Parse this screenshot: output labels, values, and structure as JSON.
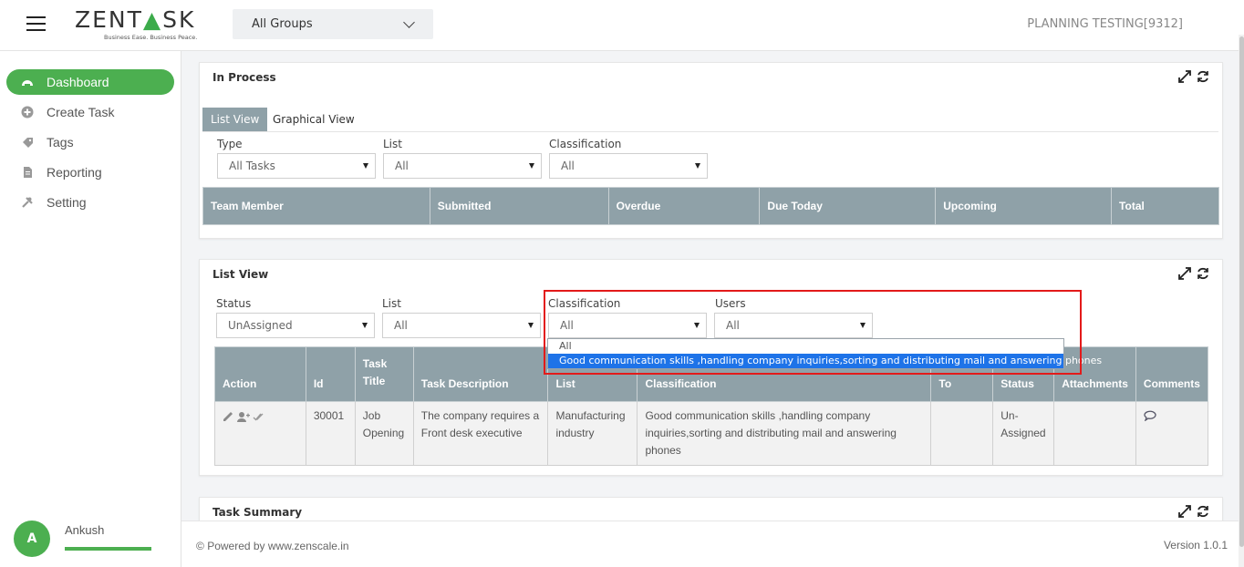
{
  "header": {
    "logo_left": "ZENT",
    "logo_right": "SK",
    "logo_tagline": "Business Ease. Business Peace.",
    "group_select": "All Groups",
    "org_name": "PLANNING TESTING[9312]"
  },
  "sidebar": {
    "items": [
      {
        "label": "Dashboard",
        "icon": "dashboard-icon"
      },
      {
        "label": "Create Task",
        "icon": "plus-circle-icon"
      },
      {
        "label": "Tags",
        "icon": "tag-icon"
      },
      {
        "label": "Reporting",
        "icon": "file-icon"
      },
      {
        "label": "Setting",
        "icon": "tools-icon"
      }
    ],
    "user": {
      "initial": "A",
      "name": "Ankush"
    }
  },
  "in_process": {
    "title": "In Process",
    "tabs": [
      "List View",
      "Graphical View"
    ],
    "filters": {
      "type_label": "Type",
      "type_value": "All Tasks",
      "list_label": "List",
      "list_value": "All",
      "class_label": "Classification",
      "class_value": "All"
    },
    "columns": [
      "Team Member",
      "Submitted",
      "Overdue",
      "Due Today",
      "Upcoming",
      "Total"
    ]
  },
  "list_view": {
    "title": "List View",
    "filters": {
      "status_label": "Status",
      "status_value": "UnAssigned",
      "list_label": "List",
      "list_value": "All",
      "class_label": "Classification",
      "class_value": "All",
      "users_label": "Users",
      "users_value": "All"
    },
    "dropdown_options": [
      "All",
      "Good communication skills ,handling company inquiries,sorting and distributing mail and answering phones"
    ],
    "columns": [
      "Action",
      "Id",
      "Task Title",
      "Task Description",
      "List",
      "Classification",
      "To",
      "Status",
      "Attachments",
      "Comments"
    ],
    "rows": [
      {
        "id": "30001",
        "title": "Job Opening",
        "description": "The company requires a Front desk executive",
        "list": "Manufacturing industry",
        "classification": "Good communication skills ,handling company inquiries,sorting and distributing mail and answering phones",
        "to": "",
        "status": "Un-Assigned",
        "attachments": ""
      }
    ]
  },
  "task_summary": {
    "title": "Task Summary"
  },
  "footer": {
    "powered": "Powered by www.zenscale.in",
    "copyright": "©",
    "version": "Version 1.0.1"
  },
  "colors": {
    "accent": "#4caf50",
    "table_header": "#8fa1a8",
    "highlight": "#e31a1a",
    "selected": "#1e73e8"
  }
}
